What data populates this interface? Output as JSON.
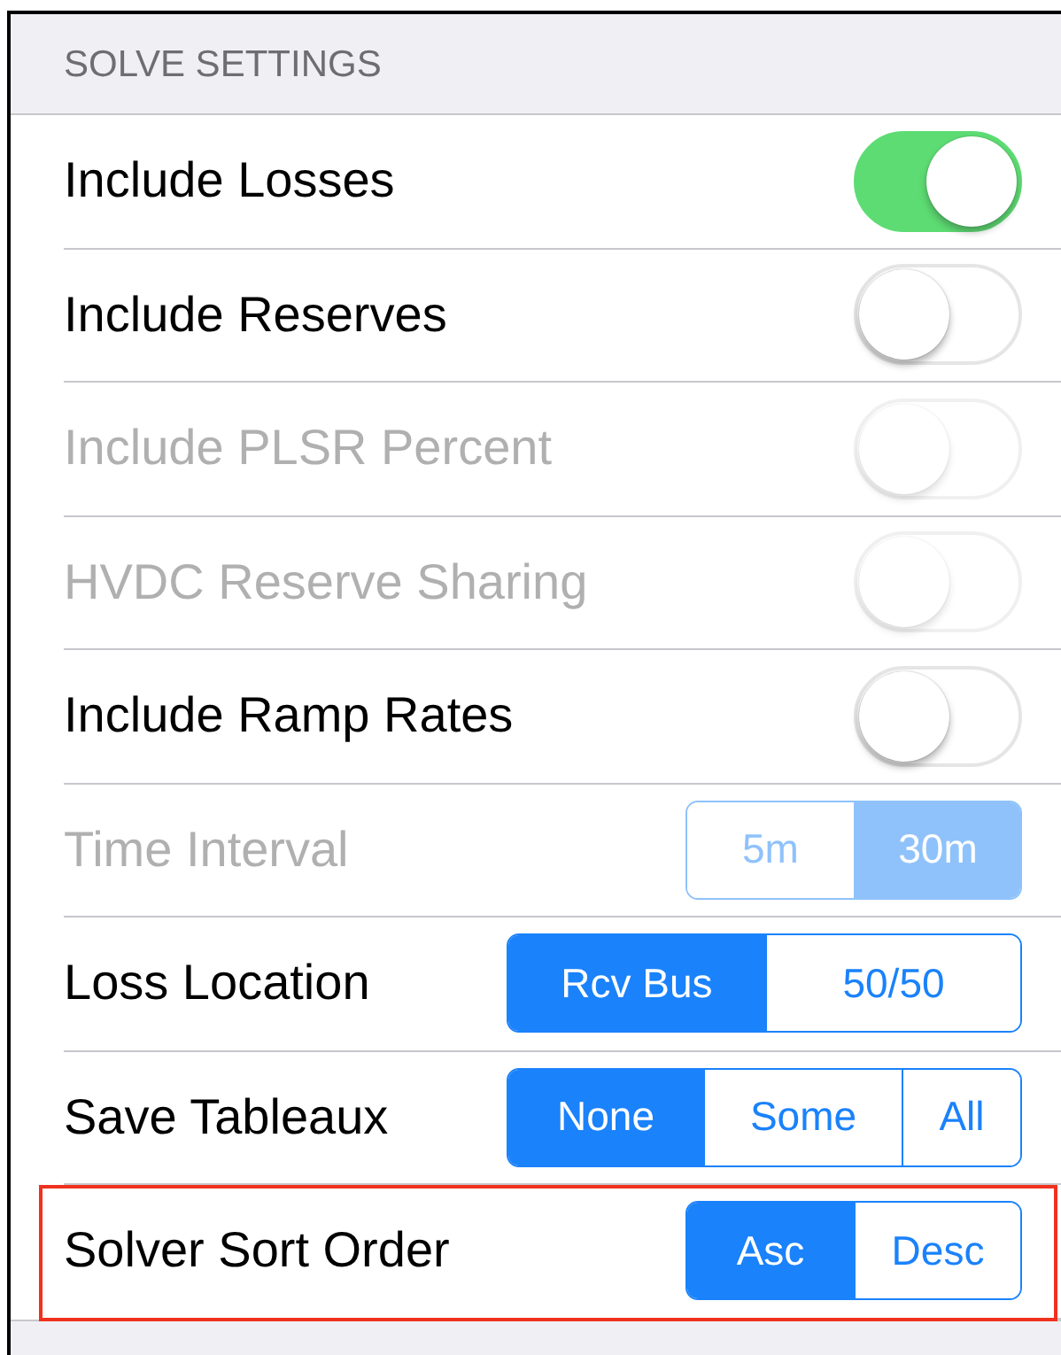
{
  "section": {
    "title": "SOLVE SETTINGS"
  },
  "rows": [
    {
      "kind": "toggle",
      "label": "Include Losses",
      "on": true,
      "disabled": false,
      "highlighted": false
    },
    {
      "kind": "toggle",
      "label": "Include Reserves",
      "on": false,
      "disabled": false,
      "highlighted": false
    },
    {
      "kind": "toggle",
      "label": "Include PLSR Percent",
      "on": false,
      "disabled": true,
      "highlighted": false
    },
    {
      "kind": "toggle",
      "label": "HVDC Reserve Sharing",
      "on": false,
      "disabled": true,
      "highlighted": false
    },
    {
      "kind": "toggle",
      "label": "Include Ramp Rates",
      "on": false,
      "disabled": false,
      "highlighted": false
    },
    {
      "kind": "segmented",
      "label": "Time Interval",
      "disabled": true,
      "highlighted": false,
      "options": [
        {
          "label": "5m",
          "selected": false
        },
        {
          "label": "30m",
          "selected": true
        }
      ]
    },
    {
      "kind": "segmented",
      "label": "Loss Location",
      "disabled": false,
      "highlighted": false,
      "options": [
        {
          "label": "Rcv Bus",
          "selected": true
        },
        {
          "label": "50/50",
          "selected": false
        }
      ]
    },
    {
      "kind": "segmented",
      "label": "Save Tableaux",
      "disabled": false,
      "highlighted": false,
      "options": [
        {
          "label": "None",
          "selected": true
        },
        {
          "label": "Some",
          "selected": false
        },
        {
          "label": "All",
          "selected": false
        }
      ]
    },
    {
      "kind": "segmented",
      "label": "Solver Sort Order",
      "disabled": false,
      "highlighted": true,
      "options": [
        {
          "label": "Asc",
          "selected": true
        },
        {
          "label": "Desc",
          "selected": false
        }
      ]
    }
  ]
}
